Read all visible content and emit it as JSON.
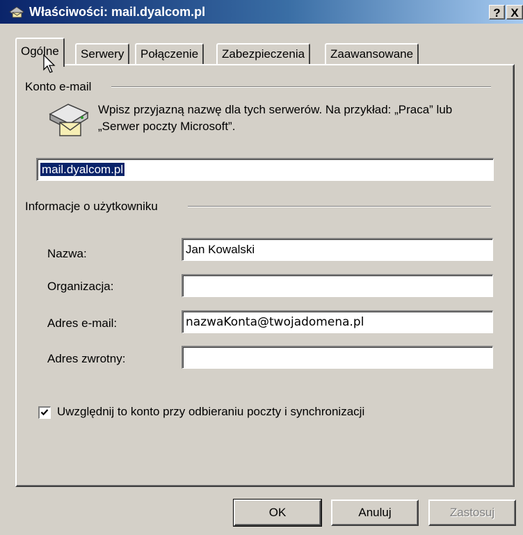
{
  "window": {
    "title": "Właściwości: mail.dyalcom.pl",
    "help_label": "?",
    "close_label": "X"
  },
  "tabs": [
    {
      "label": "Ogólne",
      "active": true
    },
    {
      "label": "Serwery",
      "active": false
    },
    {
      "label": "Połączenie",
      "active": false
    },
    {
      "label": "Zabezpieczenia",
      "active": false
    },
    {
      "label": "Zaawansowane",
      "active": false
    }
  ],
  "account": {
    "group_label": "Konto e-mail",
    "description_line1": "Wpisz przyjazną nazwę dla tych serwerów. Na przykład: „Praca” lub",
    "description_line2": "„Serwer poczty Microsoft”.",
    "name_value": "mail.dyalcom.pl"
  },
  "user": {
    "group_label": "Informacje o użytkowniku",
    "name_label": "Nazwa:",
    "name_value": "Jan Kowalski",
    "org_label": "Organizacja:",
    "org_value": "",
    "email_label": "Adres e-mail:",
    "email_value": "nazwaKonta@twojadomena.pl",
    "reply_label": "Adres zwrotny:",
    "reply_value": ""
  },
  "include_checkbox": {
    "label": "Uwzględnij to konto przy odbieraniu poczty i synchronizacji",
    "checked": true
  },
  "buttons": {
    "ok": "OK",
    "cancel": "Anuluj",
    "apply": "Zastosuj"
  },
  "colors": {
    "title_bar": "#0a246a",
    "face": "#d4d0c8",
    "selection": "#0a246a"
  }
}
